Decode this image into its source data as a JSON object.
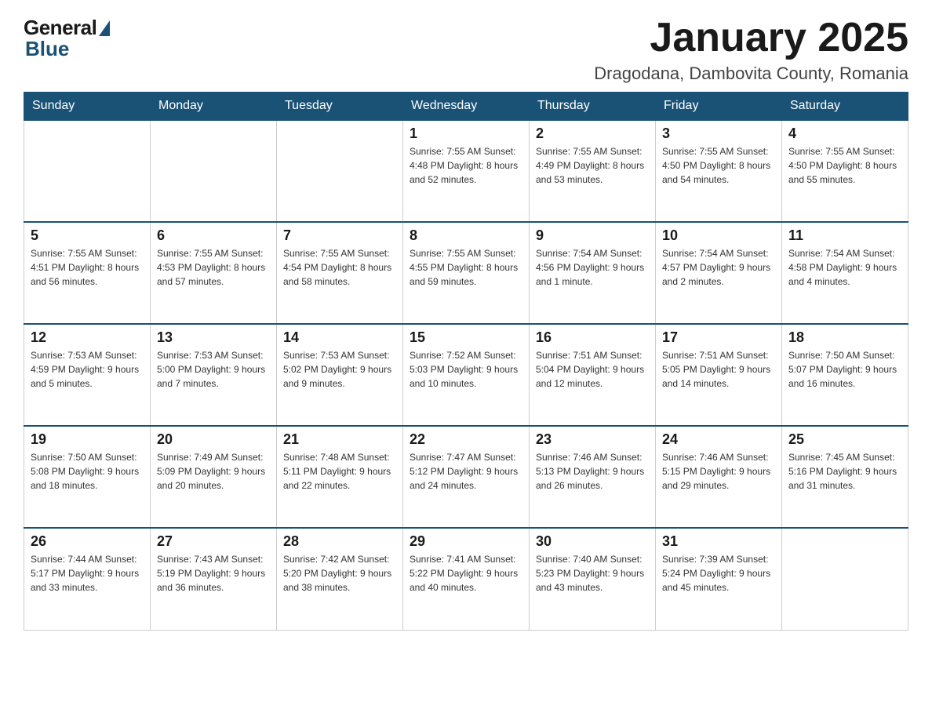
{
  "header": {
    "logo": {
      "general_text": "General",
      "blue_text": "Blue"
    },
    "title": "January 2025",
    "location": "Dragodana, Dambovita County, Romania"
  },
  "weekdays": [
    "Sunday",
    "Monday",
    "Tuesday",
    "Wednesday",
    "Thursday",
    "Friday",
    "Saturday"
  ],
  "weeks": [
    [
      {
        "day": "",
        "info": ""
      },
      {
        "day": "",
        "info": ""
      },
      {
        "day": "",
        "info": ""
      },
      {
        "day": "1",
        "info": "Sunrise: 7:55 AM\nSunset: 4:48 PM\nDaylight: 8 hours\nand 52 minutes."
      },
      {
        "day": "2",
        "info": "Sunrise: 7:55 AM\nSunset: 4:49 PM\nDaylight: 8 hours\nand 53 minutes."
      },
      {
        "day": "3",
        "info": "Sunrise: 7:55 AM\nSunset: 4:50 PM\nDaylight: 8 hours\nand 54 minutes."
      },
      {
        "day": "4",
        "info": "Sunrise: 7:55 AM\nSunset: 4:50 PM\nDaylight: 8 hours\nand 55 minutes."
      }
    ],
    [
      {
        "day": "5",
        "info": "Sunrise: 7:55 AM\nSunset: 4:51 PM\nDaylight: 8 hours\nand 56 minutes."
      },
      {
        "day": "6",
        "info": "Sunrise: 7:55 AM\nSunset: 4:53 PM\nDaylight: 8 hours\nand 57 minutes."
      },
      {
        "day": "7",
        "info": "Sunrise: 7:55 AM\nSunset: 4:54 PM\nDaylight: 8 hours\nand 58 minutes."
      },
      {
        "day": "8",
        "info": "Sunrise: 7:55 AM\nSunset: 4:55 PM\nDaylight: 8 hours\nand 59 minutes."
      },
      {
        "day": "9",
        "info": "Sunrise: 7:54 AM\nSunset: 4:56 PM\nDaylight: 9 hours\nand 1 minute."
      },
      {
        "day": "10",
        "info": "Sunrise: 7:54 AM\nSunset: 4:57 PM\nDaylight: 9 hours\nand 2 minutes."
      },
      {
        "day": "11",
        "info": "Sunrise: 7:54 AM\nSunset: 4:58 PM\nDaylight: 9 hours\nand 4 minutes."
      }
    ],
    [
      {
        "day": "12",
        "info": "Sunrise: 7:53 AM\nSunset: 4:59 PM\nDaylight: 9 hours\nand 5 minutes."
      },
      {
        "day": "13",
        "info": "Sunrise: 7:53 AM\nSunset: 5:00 PM\nDaylight: 9 hours\nand 7 minutes."
      },
      {
        "day": "14",
        "info": "Sunrise: 7:53 AM\nSunset: 5:02 PM\nDaylight: 9 hours\nand 9 minutes."
      },
      {
        "day": "15",
        "info": "Sunrise: 7:52 AM\nSunset: 5:03 PM\nDaylight: 9 hours\nand 10 minutes."
      },
      {
        "day": "16",
        "info": "Sunrise: 7:51 AM\nSunset: 5:04 PM\nDaylight: 9 hours\nand 12 minutes."
      },
      {
        "day": "17",
        "info": "Sunrise: 7:51 AM\nSunset: 5:05 PM\nDaylight: 9 hours\nand 14 minutes."
      },
      {
        "day": "18",
        "info": "Sunrise: 7:50 AM\nSunset: 5:07 PM\nDaylight: 9 hours\nand 16 minutes."
      }
    ],
    [
      {
        "day": "19",
        "info": "Sunrise: 7:50 AM\nSunset: 5:08 PM\nDaylight: 9 hours\nand 18 minutes."
      },
      {
        "day": "20",
        "info": "Sunrise: 7:49 AM\nSunset: 5:09 PM\nDaylight: 9 hours\nand 20 minutes."
      },
      {
        "day": "21",
        "info": "Sunrise: 7:48 AM\nSunset: 5:11 PM\nDaylight: 9 hours\nand 22 minutes."
      },
      {
        "day": "22",
        "info": "Sunrise: 7:47 AM\nSunset: 5:12 PM\nDaylight: 9 hours\nand 24 minutes."
      },
      {
        "day": "23",
        "info": "Sunrise: 7:46 AM\nSunset: 5:13 PM\nDaylight: 9 hours\nand 26 minutes."
      },
      {
        "day": "24",
        "info": "Sunrise: 7:46 AM\nSunset: 5:15 PM\nDaylight: 9 hours\nand 29 minutes."
      },
      {
        "day": "25",
        "info": "Sunrise: 7:45 AM\nSunset: 5:16 PM\nDaylight: 9 hours\nand 31 minutes."
      }
    ],
    [
      {
        "day": "26",
        "info": "Sunrise: 7:44 AM\nSunset: 5:17 PM\nDaylight: 9 hours\nand 33 minutes."
      },
      {
        "day": "27",
        "info": "Sunrise: 7:43 AM\nSunset: 5:19 PM\nDaylight: 9 hours\nand 36 minutes."
      },
      {
        "day": "28",
        "info": "Sunrise: 7:42 AM\nSunset: 5:20 PM\nDaylight: 9 hours\nand 38 minutes."
      },
      {
        "day": "29",
        "info": "Sunrise: 7:41 AM\nSunset: 5:22 PM\nDaylight: 9 hours\nand 40 minutes."
      },
      {
        "day": "30",
        "info": "Sunrise: 7:40 AM\nSunset: 5:23 PM\nDaylight: 9 hours\nand 43 minutes."
      },
      {
        "day": "31",
        "info": "Sunrise: 7:39 AM\nSunset: 5:24 PM\nDaylight: 9 hours\nand 45 minutes."
      },
      {
        "day": "",
        "info": ""
      }
    ]
  ]
}
